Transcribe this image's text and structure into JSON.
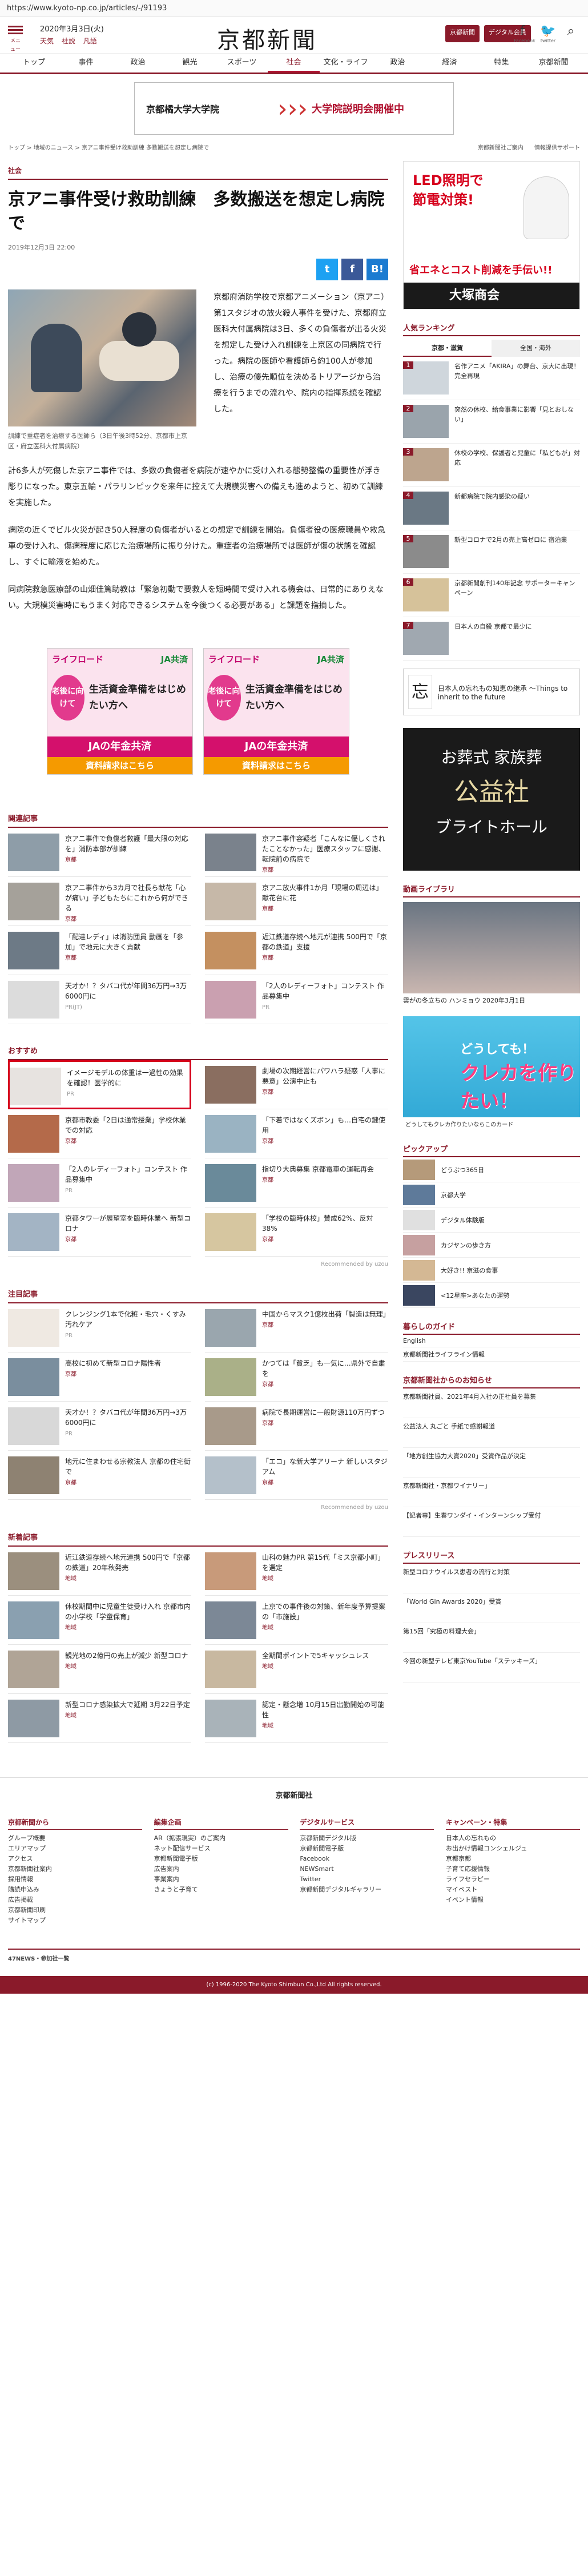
{
  "url": "https://www.kyoto-np.co.jp/articles/-/91193",
  "header": {
    "menu_label": "メニュー",
    "date": "2020年3月3日(火)",
    "weather": [
      "天気",
      "社説",
      "凡語"
    ],
    "logo": "京都新聞",
    "btn_search": "京都新聞",
    "btn_digital": "デジタル会員",
    "facebook_label": "Facebook",
    "twitter_label": "twitter"
  },
  "nav": [
    "トップ",
    "事件",
    "政治",
    "観光",
    "スポーツ",
    "社会",
    "文化・ライフ",
    "政治",
    "経済",
    "特集",
    "京都新聞"
  ],
  "ad_top": {
    "left": "京都橘大学大学院",
    "right": "大学院説明会開催中"
  },
  "breadcrumb": "トップ > 地域のニュース > 京アニ事件受け救助訓練 多数搬送を想定し病院で",
  "side_links": [
    "京都新聞社ご案内",
    "情報提供サポート"
  ],
  "article": {
    "category": "社会",
    "title": "京アニ事件受け救助訓練　多数搬送を想定し病院で",
    "date": "2019年12月3日 22:00",
    "caption": "訓練で重症者を治療する医師ら（3日午後3時52分、京都市上京区・府立医科大付属病院）",
    "lead": "京都府消防学校で京都アニメーション（京アニ）第1スタジオの放火殺人事件を受けた、京都府立医科大付属病院は3日、多くの負傷者が出る火災を想定した受け入れ訓練を上京区の同病院で行った。病院の医師や看護師ら約100人が参加し、治療の優先順位を決めるトリアージから治療を行うまでの流れや、院内の指揮系統を確認した。",
    "p1": "計6多人が死傷した京アニ事件では、多数の負傷者を病院が速やかに受け入れる態勢整備の重要性が浮き彫りになった。東京五輪・パラリンピックを来年に控えて大規模災害への備えも進めようと、初めて訓練を実施した。",
    "p2": "病院の近くでビル火災が起き50人程度の負傷者がいるとの想定で訓練を開始。負傷者役の医療職員や救急車の受け入れ、傷病程度に応じた治療場所に振り分けた。重症者の治療場所では医師が傷の状態を確認し、すぐに輸液を始めた。",
    "p3": "同病院救急医療部の山畑佳篤助教は「緊急初動で要救人を短時間で受け入れる機会は、日常的にありえない。大規模災害時にもうまく対応できるシステムを今後つくる必要がある」と課題を指摘した。"
  },
  "ja_ad": {
    "brand": "ライフロード",
    "ja": "JA共済",
    "circle": "老後に向けて",
    "text": "生活資金準備をはじめたい方へ",
    "band": "JAの年金共済",
    "cta": "資料請求はこちら"
  },
  "related": {
    "heading": "関連記事",
    "items": [
      {
        "title": "京アニ事件で負傷者救護「最大限の対応を」消防本部が訓練",
        "src": "京都"
      },
      {
        "title": "京アニ事件容疑者「こんなに優しくされたことなかった」医療スタッフに感謝、転院前の病院で",
        "src": "京都"
      },
      {
        "title": "京アニ事件から3カ月で社長ら献花「心が痛い」子どもたちにこれから何ができる",
        "src": "京都"
      },
      {
        "title": "京アニ放火事件1か月「現場の周辺は」献花台に花",
        "src": "京都"
      },
      {
        "title": "「配達レディ」は消防団員 動画を「参加」で地元に大きく貢献",
        "src": "京都"
      },
      {
        "title": "近江鉄道存続へ地元が連携 500円で「京都の鉄道」支援",
        "src": "京都"
      },
      {
        "title": "天才か！？タバコ代が年間36万円→3万6000円に",
        "src": "PR(JT)"
      },
      {
        "title": "「2人のレディーフォト」コンテスト 作品募集中",
        "src": "PR"
      }
    ]
  },
  "recommend": {
    "heading": "おすすめ",
    "items": [
      {
        "title": "イメージモデルの体重は一過性の効果を確認！医学的に",
        "src": "PR"
      },
      {
        "title": "劇場の次期経営にパワハラ疑惑「人事に悪意」公演中止も",
        "src": "京都"
      },
      {
        "title": "京都市教委「2日は通常授業」学校休業での対応",
        "src": "京都"
      },
      {
        "title": "「下着ではなくズボン」も…自宅の鍵使用",
        "src": "京都"
      },
      {
        "title": "「2人のレディーフォト」コンテスト 作品募集中",
        "src": "PR"
      },
      {
        "title": "指切り大典募集 京都電車の運転再会",
        "src": "京都"
      },
      {
        "title": "京都タワーが展望室を臨時休業へ 新型コロナ",
        "src": "京都"
      },
      {
        "title": "「学校の臨時休校」賛成62%、反対38%",
        "src": "京都"
      }
    ]
  },
  "attention": {
    "heading": "注目記事",
    "items": [
      {
        "title": "クレンジング1本で化粧・毛穴・くすみ汚れケア",
        "src": "PR"
      },
      {
        "title": "中国からマスク1億枚出荷「製造は無理」",
        "src": "京都"
      },
      {
        "title": "高校に初めて新型コロナ陽性者",
        "src": "京都"
      },
      {
        "title": "かつては「貧乏」も一気に…県外で自粛を",
        "src": "京都"
      },
      {
        "title": "天才か！？タバコ代が年間36万円→3万6000円に",
        "src": "PR"
      },
      {
        "title": "病院で長期運営に一般財源110万円ずつ",
        "src": "京都"
      },
      {
        "title": "地元に住まわせる宗教法人 京都の住宅街で",
        "src": "京都"
      },
      {
        "title": "「エコ」な新大学アリーナ 新しいスタジアム",
        "src": "京都"
      }
    ]
  },
  "new_articles": {
    "heading": "新着記事",
    "items": [
      {
        "title": "近江鉄道存続へ地元連携 500円で「京都の鉄道」20年秋発売",
        "src": "地域"
      },
      {
        "title": "山科の魅力PR 第15代「ミス京都小町」を選定",
        "src": "地域"
      },
      {
        "title": "休校期間中に児童生徒受け入れ 京都市内の小学校「学童保育」",
        "src": "地域"
      },
      {
        "title": "上京での事件後の対策、新年度予算提案の「市施設」",
        "src": "地域"
      },
      {
        "title": "観光地の2億円の売上が減少 新型コロナ",
        "src": "地域"
      },
      {
        "title": "全期間ポイントで5キャッシュレス",
        "src": "地域"
      },
      {
        "title": "新型コロナ感染拡大で延期 3月22日予定",
        "src": "地域"
      },
      {
        "title": "認定・懸念増 10月15日出勤開始の可能性",
        "src": "地域"
      }
    ]
  },
  "ranking": {
    "heading": "人気ランキング",
    "tabs": [
      "京都・滋賀",
      "全国・海外"
    ],
    "items": [
      {
        "title": "名作アニメ「AKIRA」の舞台、京大に出現！ 完全再現"
      },
      {
        "title": "突然の休校、給食事業に影響「見とおしない」"
      },
      {
        "title": "休校の学校、保護者と児童に「私どもが」対応"
      },
      {
        "title": "新都病院で院内感染の疑い"
      },
      {
        "title": "新型コロナで2月の売上高ゼロに 宿泊業"
      },
      {
        "title": "京都新聞創刊140年記念 サポーターキャンペーン"
      },
      {
        "title": "日本人の自殺 京都で最少に"
      }
    ]
  },
  "gen_ad": {
    "logo": "忘",
    "text": "日本人の忘れもの知恵の継承 ～Things to inherit to the future"
  },
  "funeral_ad": {
    "a": "お葬式 家族葬",
    "b": "公益社",
    "c": "ブライトホール"
  },
  "video": {
    "heading": "動画ライブラリ",
    "caption": "雲がの冬立ちの ハンミョウ 2020年3月1日"
  },
  "card_ad": {
    "a": "どうしても！",
    "b": "クレカを作りたい！",
    "c": "どうしてもクレカ作りたいならこのカード"
  },
  "pickup": {
    "heading": "ピックアップ",
    "items": [
      "どうぶつ365日",
      "京都大学",
      "デジタル体験版",
      "カジヤンの歩き方",
      "大好き!! 京滋の食事",
      "<12星座>あなたの運勢"
    ]
  },
  "guide": {
    "heading": "暮らしのガイド",
    "items": [
      "English",
      "京都新聞社ライフライン情報"
    ]
  },
  "company_news": {
    "heading": "京都新聞社からのお知らせ",
    "items": [
      "京都新聞社員、2021年4月入社の正社員を募集",
      "公益法人 丸ごと 手紙で感謝報道",
      "「地方創生協力大賞2020」受賞作品が決定",
      "京都新聞社・京都ワイナリー」",
      "【記者専】生春ワンダイ・インターンシップ受付"
    ]
  },
  "press_release": {
    "heading": "プレスリリース",
    "items": [
      "新型コロナウイルス患者の流行と対策",
      "「World Gin Awards 2020」受賞",
      "第15回「究極の料理大会」",
      "今回の新型テレビ東京YouTube「ステッキーズ」"
    ]
  },
  "footer": {
    "logo": "京都新聞社",
    "cols": [
      {
        "h": "京都新聞から",
        "items": [
          "グループ概要",
          "エリアマップ",
          "アクセス",
          "京都新聞社案内",
          "採用情報",
          "購読申込み",
          "広告掲載",
          "京都新聞印刷",
          "サイトマップ"
        ]
      },
      {
        "h": "編集企画",
        "items": [
          "AR（拡張現実）のご案内",
          "ネット配信サービス",
          "京都新聞電子版",
          "広告案内",
          "事業案内",
          "きょうと子育て"
        ]
      },
      {
        "h": "デジタルサービス",
        "items": [
          "京都新聞デジタル版",
          "京都新聞電子版",
          "Facebook",
          "NEWSmart",
          "Twitter",
          "京都新聞デジタルギャラリー"
        ]
      },
      {
        "h": "キャンペーン・特集",
        "items": [
          "日本人の忘れもの",
          "お出かけ情報コンシェルジュ",
          "京都京都",
          "子育て応援情報",
          "ライフセラピー",
          "マイベスト",
          "イベント情報"
        ]
      }
    ]
  },
  "network_label": "47NEWS・参加社一覧",
  "copyright": "(c) 1996-2020 The Kyoto Shimbun Co.,Ltd All rights reserved."
}
